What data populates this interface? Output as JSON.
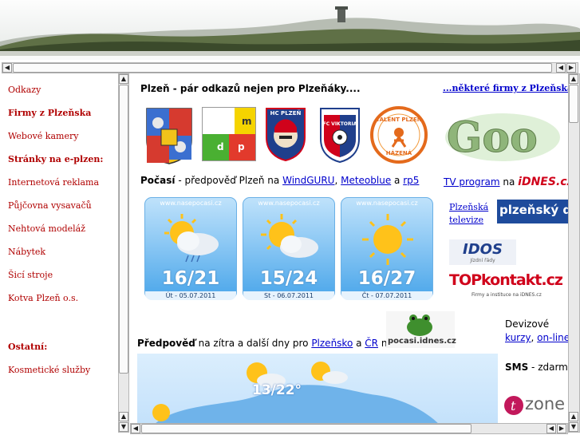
{
  "colors": {
    "nav_link": "#b00000",
    "link": "#0000cc",
    "weather_sky": "#8cc8f4"
  },
  "nav": {
    "items": [
      {
        "label": "Odkazy",
        "bold": false
      },
      {
        "label": "Firmy z Plzeňska",
        "bold": true
      },
      {
        "label": "Webové kamery",
        "bold": false
      },
      {
        "label": "Stránky na e-plzen:",
        "bold": true
      },
      {
        "label": "Internetová reklama",
        "bold": false
      },
      {
        "label": "Půjčovna vysavačů",
        "bold": false
      },
      {
        "label": "Nehtová modeláž",
        "bold": false
      },
      {
        "label": "Nábytek",
        "bold": false
      },
      {
        "label": "Šicí stroje",
        "bold": false
      },
      {
        "label": "Kotva Plzeň o.s.",
        "bold": false
      },
      {
        "label": "Ostatní:",
        "bold": true
      },
      {
        "label": "Kosmetické služby",
        "bold": false
      }
    ]
  },
  "main": {
    "heading": "Plzeň - pár odkazů nejen pro Plzeňáky....",
    "logos": {
      "pmdp": [
        "p",
        "m",
        "d",
        "p"
      ],
      "hc": "HC PLZEŇ",
      "viktoria": "FC VIKTORIA",
      "talent": "TALENT PLZEŇ",
      "hazena": "HÁZENÁ"
    },
    "weather": {
      "label_bold": "Počasí",
      "label_text": " - předpověď Plzeň na ",
      "links": [
        "WindGURU",
        "Meteoblue",
        "rp5"
      ],
      "sep1": ", ",
      "sep2": " a ",
      "cards": [
        {
          "source": "www.nasepocasi.cz",
          "temp": "16/21",
          "date": "Út - 05.07.2011",
          "icon": "rain-cloud-sun-icon"
        },
        {
          "source": "www.nasepocasi.cz",
          "temp": "15/24",
          "date": "St - 06.07.2011",
          "icon": "cloud-sun-icon"
        },
        {
          "source": "www.nasepocasi.cz",
          "temp": "16/27",
          "date": "Čt - 07.07.2011",
          "icon": "sun-icon"
        }
      ]
    },
    "forecast": {
      "bold": "Předpověď",
      "text": " na zítra a další dny pro ",
      "link1": "Plzeňsko",
      "mid": " a ",
      "link2": "ČR",
      "tail": " na",
      "logo_text": "pocasi.idnes.cz",
      "map_temp": "13/22°"
    }
  },
  "right": {
    "firms_link": "...některé firmy z Plzeňska, l",
    "tv_link": "TV program",
    "tv_na": " na ",
    "idnes": "iDNES.cz",
    "plz_tv": [
      "Plzeňská",
      "televize"
    ],
    "plz_denik": "plzeňský d",
    "idos": "IDOS",
    "idos_sub": "Jízdní řády",
    "topkontakt": "TOPkontakt.cz",
    "topkontakt_sub": "Firmy a instituce na iDNES.cz",
    "devizove": "Devizové",
    "kurzy": "kurzy",
    "online": "on-line",
    "sms_bold": "SMS",
    "sms_text": " - zdarma",
    "zone": "zone"
  },
  "scroll": {
    "up": "▲",
    "down": "▼",
    "left": "◀",
    "right": "▶"
  }
}
